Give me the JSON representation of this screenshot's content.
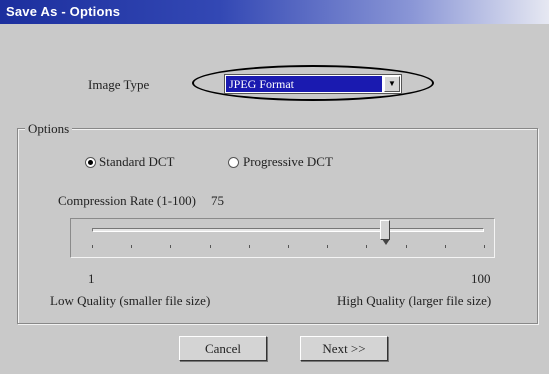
{
  "window": {
    "title": "Save As - Options"
  },
  "image_type": {
    "label": "Image Type",
    "selected": "JPEG Format"
  },
  "options": {
    "group_label": "Options",
    "radio_standard": "Standard DCT",
    "radio_progressive": "Progressive DCT",
    "selected": "Standard DCT",
    "compression_label": "Compression Rate (1-100)",
    "compression_value": "75",
    "slider": {
      "min": 1,
      "max": 100,
      "value": 75,
      "min_label": "1",
      "max_label": "100"
    },
    "low_quality_label": "Low Quality (smaller file size)",
    "high_quality_label": "High Quality (larger file size)"
  },
  "buttons": {
    "cancel": "Cancel",
    "next": "Next >>"
  }
}
